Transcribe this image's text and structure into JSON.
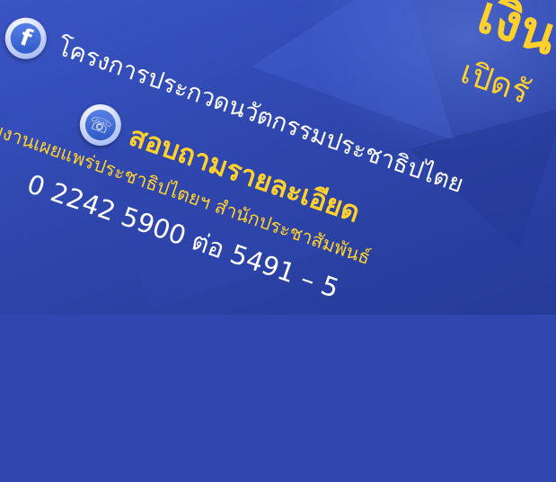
{
  "header": {
    "title_fragment": "เงินร",
    "open_text": "เปิดรั"
  },
  "facebook": {
    "icon": "facebook-icon",
    "page_name": "โครงการประกวดนวัตกรรมประชาธิปไตย"
  },
  "contact": {
    "icon": "phone-icon",
    "title": "สอบถามรายละเอียด",
    "department": "กลุ่มงานเผยแพร่ประชาธิปไตยฯ สำนักประชาสัมพันธ์",
    "phone": "0 2242 5900 ต่อ 5491 – 5"
  },
  "colors": {
    "background": "#2f47ae",
    "accent_yellow": "#ffd12a",
    "text_white": "#ffffff"
  }
}
